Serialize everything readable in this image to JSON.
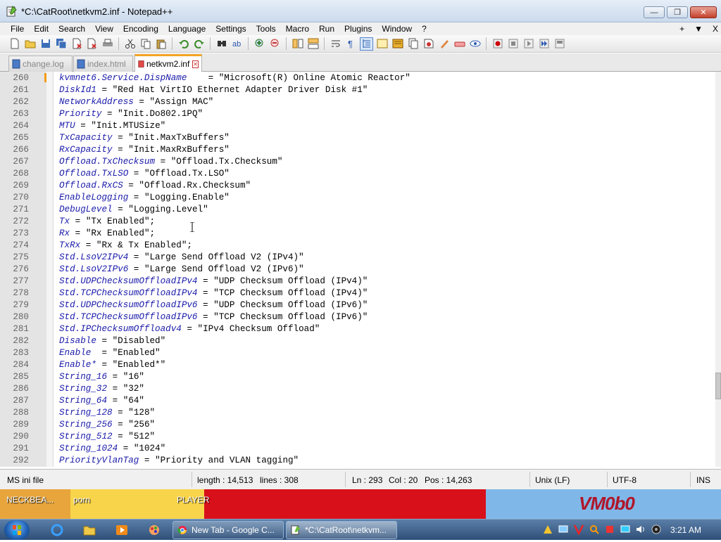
{
  "window": {
    "title": "*C:\\CatRoot\\netkvm2.inf - Notepad++",
    "min_glyph": "—",
    "max_glyph": "❐",
    "close_glyph": "✕"
  },
  "menu": {
    "items": [
      "File",
      "Edit",
      "Search",
      "View",
      "Encoding",
      "Language",
      "Settings",
      "Tools",
      "Macro",
      "Run",
      "Plugins",
      "Window",
      "?"
    ],
    "right": [
      "+",
      "▼",
      "X"
    ]
  },
  "tabs": [
    {
      "label": "change.log",
      "active": false
    },
    {
      "label": "index.html",
      "active": false
    },
    {
      "label": "netkvm2.inf",
      "active": true
    }
  ],
  "editor": {
    "lines": [
      {
        "n": "260",
        "key": "kvmnet6.Service.DispName",
        "op": "    = ",
        "val": "\"Microsoft(R) Online Atomic Reactor\""
      },
      {
        "n": "261",
        "key": "DiskId1",
        "op": " = ",
        "val": "\"Red Hat VirtIO Ethernet Adapter Driver Disk #1\""
      },
      {
        "n": "262",
        "key": "NetworkAddress",
        "op": " = ",
        "val": "\"Assign MAC\""
      },
      {
        "n": "263",
        "key": "Priority",
        "op": " = ",
        "val": "\"Init.Do802.1PQ\""
      },
      {
        "n": "264",
        "key": "MTU",
        "op": " = ",
        "val": "\"Init.MTUSize\""
      },
      {
        "n": "265",
        "key": "TxCapacity",
        "op": " = ",
        "val": "\"Init.MaxTxBuffers\""
      },
      {
        "n": "266",
        "key": "RxCapacity",
        "op": " = ",
        "val": "\"Init.MaxRxBuffers\""
      },
      {
        "n": "267",
        "key": "Offload.TxChecksum",
        "op": " = ",
        "val": "\"Offload.Tx.Checksum\""
      },
      {
        "n": "268",
        "key": "Offload.TxLSO",
        "op": " = ",
        "val": "\"Offload.Tx.LSO\""
      },
      {
        "n": "269",
        "key": "Offload.RxCS",
        "op": " = ",
        "val": "\"Offload.Rx.Checksum\""
      },
      {
        "n": "270",
        "key": "EnableLogging",
        "op": " = ",
        "val": "\"Logging.Enable\""
      },
      {
        "n": "271",
        "key": "DebugLevel",
        "op": " = ",
        "val": "\"Logging.Level\""
      },
      {
        "n": "272",
        "key": "Tx",
        "op": " = ",
        "val": "\"Tx Enabled\";"
      },
      {
        "n": "273",
        "key": "Rx",
        "op": " = ",
        "val": "\"Rx Enabled\";"
      },
      {
        "n": "274",
        "key": "TxRx",
        "op": " = ",
        "val": "\"Rx & Tx Enabled\";"
      },
      {
        "n": "275",
        "key": "Std.LsoV2IPv4",
        "op": " = ",
        "val": "\"Large Send Offload V2 (IPv4)\""
      },
      {
        "n": "276",
        "key": "Std.LsoV2IPv6",
        "op": " = ",
        "val": "\"Large Send Offload V2 (IPv6)\""
      },
      {
        "n": "277",
        "key": "Std.UDPChecksumOffloadIPv4",
        "op": " = ",
        "val": "\"UDP Checksum Offload (IPv4)\""
      },
      {
        "n": "278",
        "key": "Std.TCPChecksumOffloadIPv4",
        "op": " = ",
        "val": "\"TCP Checksum Offload (IPv4)\""
      },
      {
        "n": "279",
        "key": "Std.UDPChecksumOffloadIPv6",
        "op": " = ",
        "val": "\"UDP Checksum Offload (IPv6)\""
      },
      {
        "n": "280",
        "key": "Std.TCPChecksumOffloadIPv6",
        "op": " = ",
        "val": "\"TCP Checksum Offload (IPv6)\""
      },
      {
        "n": "281",
        "key": "Std.IPChecksumOffloadv4",
        "op": " = ",
        "val": "\"IPv4 Checksum Offload\""
      },
      {
        "n": "282",
        "key": "Disable",
        "op": " = ",
        "val": "\"Disabled\""
      },
      {
        "n": "283",
        "key": "Enable",
        "op": "  = ",
        "val": "\"Enabled\""
      },
      {
        "n": "284",
        "key": "Enable*",
        "op": " = ",
        "val": "\"Enabled*\""
      },
      {
        "n": "285",
        "key": "String_16",
        "op": " = ",
        "val": "\"16\""
      },
      {
        "n": "286",
        "key": "String_32",
        "op": " = ",
        "val": "\"32\""
      },
      {
        "n": "287",
        "key": "String_64",
        "op": " = ",
        "val": "\"64\""
      },
      {
        "n": "288",
        "key": "String_128",
        "op": " = ",
        "val": "\"128\""
      },
      {
        "n": "289",
        "key": "String_256",
        "op": " = ",
        "val": "\"256\""
      },
      {
        "n": "290",
        "key": "String_512",
        "op": " = ",
        "val": "\"512\""
      },
      {
        "n": "291",
        "key": "String_1024",
        "op": " = ",
        "val": "\"1024\""
      },
      {
        "n": "292",
        "key": "PriorityVlanTag",
        "op": " = ",
        "val": "\"Priority and VLAN tagging\""
      }
    ]
  },
  "status": {
    "file_type": "MS ini file",
    "length": "length : 14,513",
    "lines": "lines : 308",
    "ln": "Ln : 293",
    "col": "Col : 20",
    "pos": "Pos : 14,263",
    "eol": "Unix (LF)",
    "encoding": "UTF-8",
    "mode": "INS"
  },
  "desktop": {
    "label_left": "NECKBEA...",
    "label_mid": "porn",
    "label_player": "PLAYER",
    "brand": "VM0b0"
  },
  "taskbar": {
    "buttons": [
      "New Tab - Google C...",
      "*C:\\CatRoot\\netkvm..."
    ],
    "clock": "3:21 AM"
  },
  "colors": {
    "accent_tab": "#f5a623",
    "keyword": "#1a1aaa"
  }
}
